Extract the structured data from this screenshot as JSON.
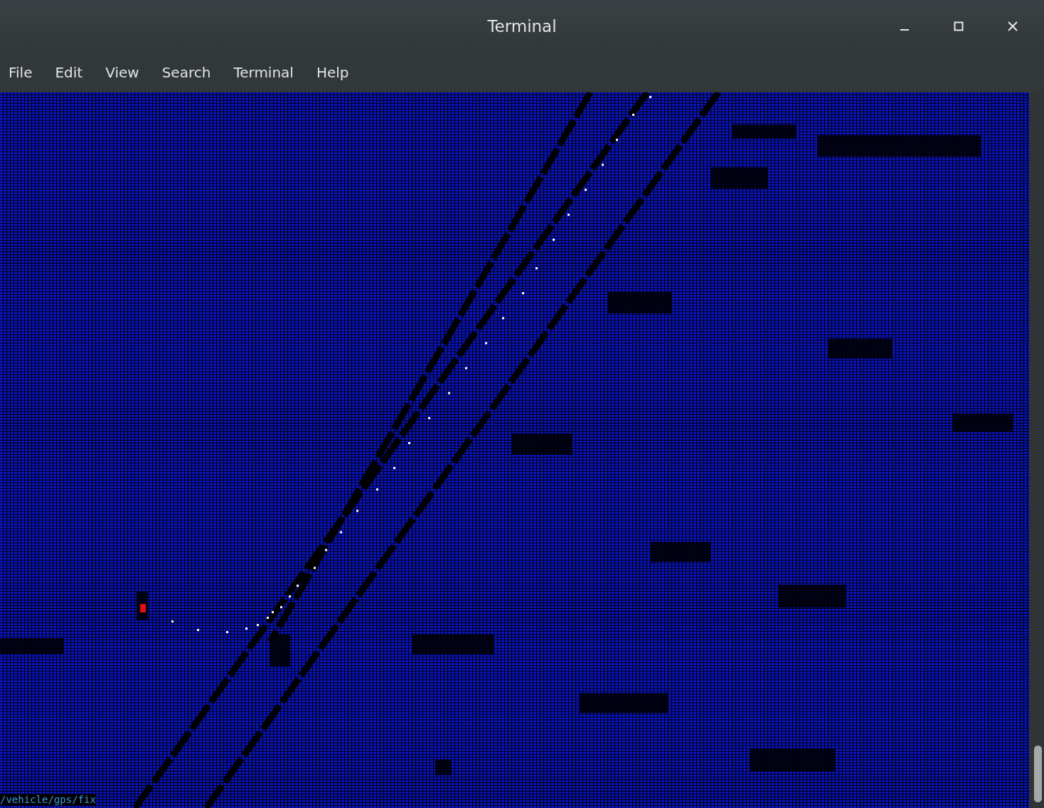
{
  "window": {
    "title": "Terminal"
  },
  "menu": [
    {
      "label": "File"
    },
    {
      "label": "Edit"
    },
    {
      "label": "View"
    },
    {
      "label": "Search"
    },
    {
      "label": "Terminal"
    },
    {
      "label": "Help"
    }
  ],
  "terminal": {
    "status_line": "/vehicle/gps/fix"
  }
}
